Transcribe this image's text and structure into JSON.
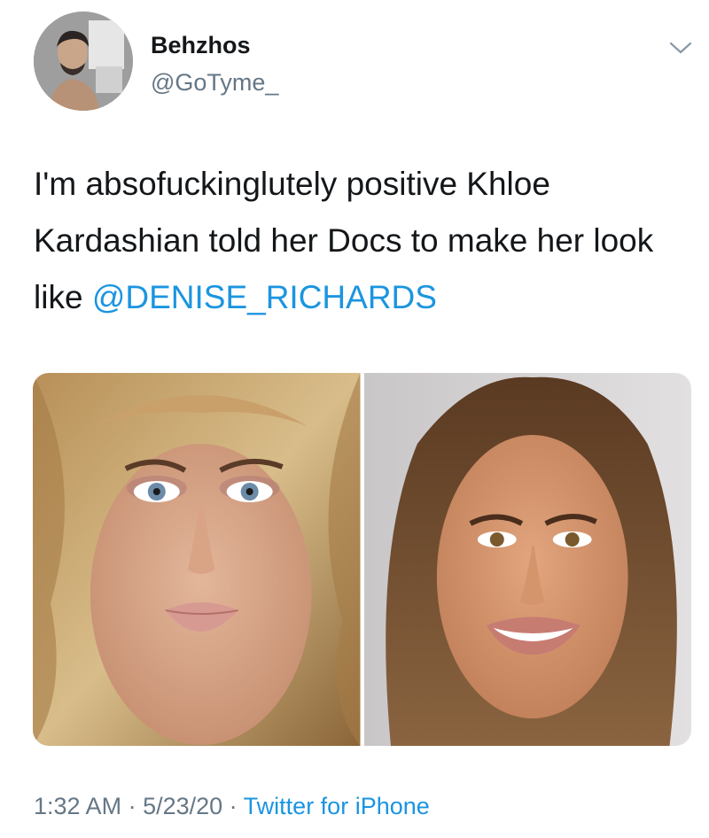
{
  "user": {
    "display_name": "Behzhos",
    "handle": "@GoTyme_"
  },
  "tweet": {
    "text_before": "I'm absofuckinglutely positive Khloe Kardashian told her Docs to make her look like ",
    "mention": "@DENISE_RICHARDS"
  },
  "meta": {
    "time": "1:32 AM",
    "separator_1": " · ",
    "date": "5/23/20",
    "separator_2": " · ",
    "source": "Twitter for iPhone"
  },
  "colors": {
    "link": "#1b95e0",
    "secondary_text": "#657786",
    "primary_text": "#14171a"
  },
  "icons": {
    "more": "chevron-down-icon"
  }
}
